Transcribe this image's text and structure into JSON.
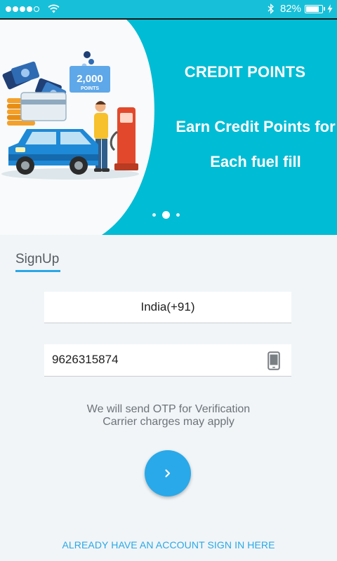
{
  "status_bar": {
    "battery_percent": "82%",
    "battery_level": 0.82,
    "signal_bars_filled": 4,
    "signal_bars_total": 5,
    "icons": [
      "signal-dots-icon",
      "wifi-icon",
      "bluetooth-icon",
      "battery-icon",
      "charging-icon"
    ]
  },
  "banner": {
    "badge_value": "2,000",
    "badge_unit": "POINTS",
    "title": "CREDIT POINTS",
    "subtitle_line1": "Earn Credit Points for",
    "subtitle_line2": "Each fuel fill",
    "pages_total": 3,
    "active_page": 2,
    "colors": {
      "background": "#00bcd4"
    }
  },
  "signup": {
    "tab_label": "SignUp",
    "country": "India(+91)",
    "phone_value": "9626315874",
    "phone_icon": "mobile-phone-icon",
    "otp_line1": "We will send OTP for Verification",
    "otp_line2": "Carrier charges may apply",
    "next_icon": "chevron-right-icon",
    "signin_link": "ALREADY HAVE AN ACCOUNT SIGN IN HERE",
    "colors": {
      "accent": "#29a9e9",
      "form_background": "#f1f5f8"
    }
  }
}
